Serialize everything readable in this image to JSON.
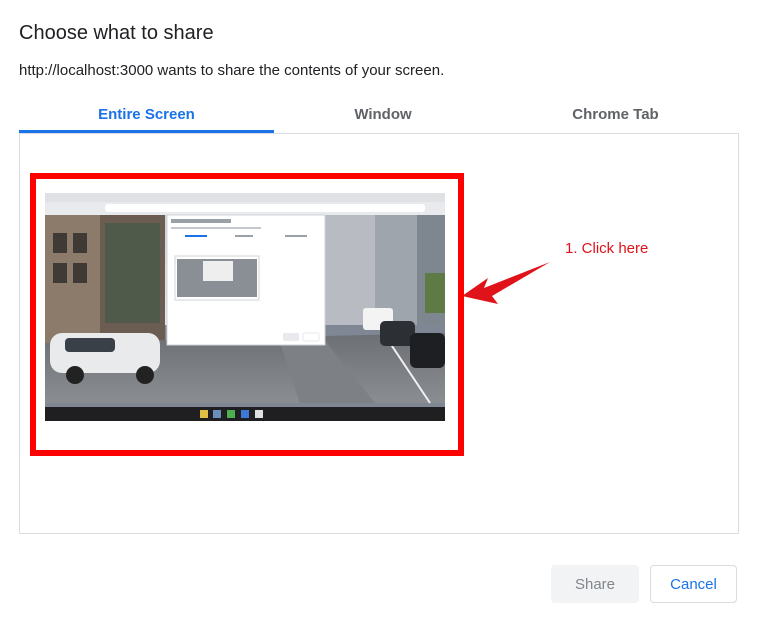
{
  "dialog": {
    "title": "Choose what to share",
    "subtitle": "http://localhost:3000 wants to share the contents of your screen."
  },
  "tabs": [
    {
      "label": "Entire Screen",
      "active": true
    },
    {
      "label": "Window",
      "active": false
    },
    {
      "label": "Chrome Tab",
      "active": false
    }
  ],
  "annotation": {
    "text": "1. Click here",
    "color": "#e0121a"
  },
  "buttons": {
    "share_label": "Share",
    "cancel_label": "Cancel"
  },
  "colors": {
    "accent": "#1a73e8",
    "highlight": "#ff0000"
  }
}
